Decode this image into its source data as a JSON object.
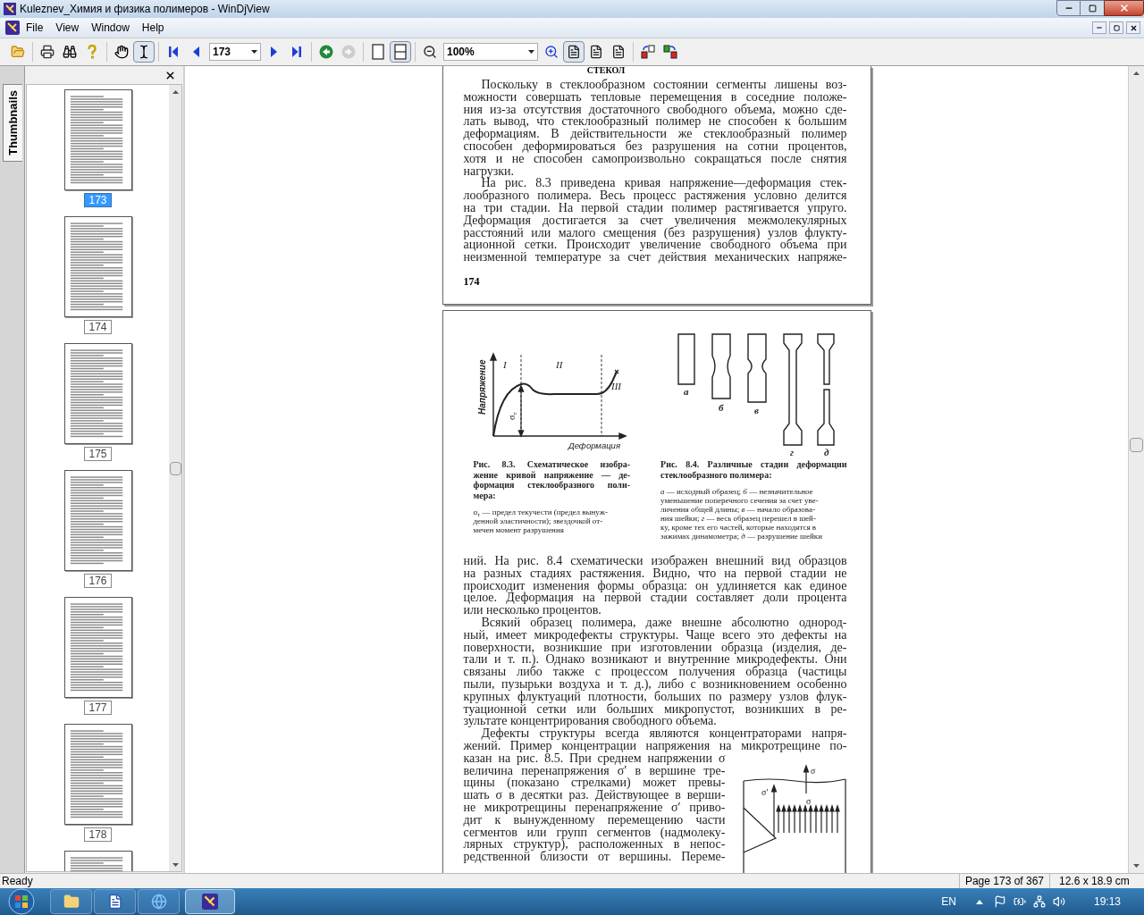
{
  "window": {
    "title": "Kuleznev_Химия и физика полимеров - WinDjView"
  },
  "menu": [
    "File",
    "View",
    "Window",
    "Help"
  ],
  "toolbar": {
    "tool_buttons": [
      {
        "pressed": false
      },
      {
        "pressed": true
      }
    ],
    "page": "173",
    "history_buttons": [
      {
        "disabled": false
      },
      {
        "disabled": true
      }
    ],
    "layout_buttons": [
      {
        "pressed": false
      },
      {
        "pressed": true
      }
    ],
    "zoom": "100%",
    "view_buttons": [
      {
        "pressed": true
      },
      {
        "pressed": false
      },
      {
        "pressed": false
      }
    ]
  },
  "sidebar": {
    "tab": "Thumbnails",
    "thumbnails": [
      {
        "page": "173",
        "selected": true
      },
      {
        "page": "174",
        "selected": false
      },
      {
        "page": "175",
        "selected": false
      },
      {
        "page": "176",
        "selected": false
      },
      {
        "page": "177",
        "selected": false
      },
      {
        "page": "178",
        "selected": false
      }
    ],
    "next_thumbnail_partly_shown": true
  },
  "pages": [
    {
      "heading": "СТЕКОЛ",
      "paragraphs": [
        {
          "indent": true,
          "continues": false,
          "lines": [
            "Поскольку в стеклообразном состоянии сегменты лишены воз-",
            "можности совершать тепловые перемещения в соседние положе-",
            "ния из-за отсутствия достаточного свободного объема, можно сде-",
            "лать вывод, что стеклообразный полимер не способен к большим",
            "деформациям. В действительности же стеклообразный полимер",
            "способен деформироваться без разрушения на сотни процентов,",
            "хотя и не способен самопроизвольно сокращаться после снятия",
            "нагрузки."
          ]
        },
        {
          "indent": true,
          "continues": true,
          "lines": [
            "На рис. 8.3 приведена кривая напряжение—деформация стек-",
            "лообразного полимера. Весь процесс растяжения условно делится",
            "на три стадии. На первой стадии полимер растягивается упруго.",
            "Деформация достигается за счет увеличения межмолекулярных",
            "расстояний или малого смещения (без разрушения) узлов флукту-",
            "ационной сетки. Происходит увеличение свободного объема при",
            "неизменной температуре за счет действия механических напряже-"
          ]
        }
      ],
      "page_number": "174"
    },
    {
      "figures": [
        {
          "kind": "curve",
          "y_label": "Напряжение",
          "x_label": "Деформация",
          "stages": [
            "I",
            "II",
            "III"
          ],
          "sigma": "σ",
          "sigma_sub": "т",
          "caption": [
            "Рис. 8.3. Схематическое изобра-",
            "жение кривой напряжение — де-",
            "формация стеклообразного поли-",
            "мера:"
          ],
          "legend": [
            "σ$_{т}$ — предел текучести (предел вынуж-",
            "денной эластичности); звездочкой от-",
            "мечен момент разрушения"
          ]
        },
        {
          "kind": "specimens",
          "letters": [
            "а",
            "б",
            "в",
            "г",
            "д"
          ],
          "caption": [
            "Рис. 8.4. Различные стадии деформации",
            "стеклообразного полимера:"
          ],
          "legend": [
            "*а* — исходный образец; *б* — незначительное",
            "уменьшение поперечного сечения за счет уве-",
            "личения общей длины; *в* — начало образова-",
            "ния шейки; *г* — весь образец перешел в шей-",
            "ку, кроме тех его частей, которые находятся в",
            "зажимах динамометра; *д* — разрушение шейки"
          ]
        }
      ],
      "paragraphs": [
        {
          "indent": false,
          "continues": false,
          "lines": [
            "ний. На рис. 8.4 схематически изображен внешний вид образцов",
            "на разных стадиях растяжения. Видно, что на первой стадии не",
            "происходит изменения формы образца: он удлиняется как единое",
            "целое. Деформация на первой стадии составляет доли процента",
            "или несколько процентов."
          ]
        },
        {
          "indent": true,
          "continues": false,
          "lines": [
            "Всякий образец полимера, даже внешне абсолютно однород-",
            "ный, имеет микродефекты структуры. Чаще всего это дефекты на",
            "поверхности, возникшие при изготовлении образца (изделия, де-",
            "тали и т. п.). Однако возникают и внутренние микродефекты. Они",
            "связаны либо также с процессом получения образца (частицы",
            "пыли, пузырьки воздуха и т. д.), либо с возникновением особенно",
            "крупных флуктуаций плотности, больших по размеру узлов флук-",
            "туационной сетки или больших микропустот, возникших в ре-",
            "зультате концентрирования свободного объема."
          ]
        },
        {
          "indent": true,
          "continues": true,
          "lines": [
            "Дефекты структуры всегда являются концентраторами напря-",
            "жений. Пример концентрации напряжения на микротрещине по-"
          ]
        }
      ],
      "side_paragraph": {
        "indent": false,
        "continues": true,
        "lines": [
          "казан на рис. 8.5. При среднем напряжении σ",
          "величина перенапряжения σ′ в вершине тре-",
          "щины (показано стрелками) может превы-",
          "шать σ в десятки раз. Действующее в верши-",
          "не микротрещины перенапряжение σ′ приво-",
          "дит к вынужденному перемещению части",
          "сегментов или групп сегментов (надмолеку-",
          "лярных структур), расположенных в непос-",
          "редственной близости от вершины. Переме-"
        ]
      },
      "crack_figure": {
        "top_label": "σ",
        "tip_label": "σ′",
        "mid_label": "σ"
      }
    }
  ],
  "status_bar": {
    "message": "Ready",
    "page": "Page 173 of 367",
    "size": "12.6 x 18.9 cm"
  },
  "taskbar": {
    "language": "EN",
    "clock": "19:13"
  }
}
